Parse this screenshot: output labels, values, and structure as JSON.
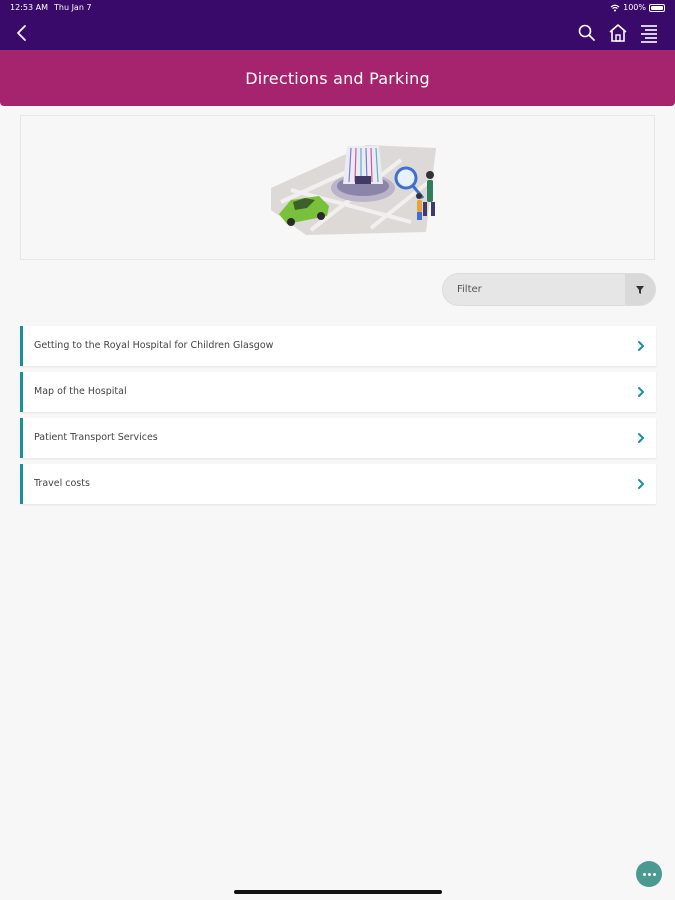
{
  "status_bar": {
    "time": "12:53 AM",
    "day": "Thu Jan 7",
    "battery": "100%"
  },
  "nav": {
    "back_icon": "chevron-left-icon",
    "search_icon": "search-icon",
    "home_icon": "home-icon",
    "menu_icon": "menu-icon"
  },
  "page": {
    "title": "Directions and Parking"
  },
  "filter": {
    "label": "Filter",
    "icon": "funnel-icon"
  },
  "items": [
    {
      "label": "Getting to the Royal Hospital for Children Glasgow"
    },
    {
      "label": "Map of the Hospital"
    },
    {
      "label": "Patient Transport Services"
    },
    {
      "label": "Travel costs"
    }
  ],
  "colors": {
    "nav_bg": "#3a0a6b",
    "title_bg": "#a6236e",
    "accent": "#1a9196",
    "fab": "#4a9a92"
  }
}
